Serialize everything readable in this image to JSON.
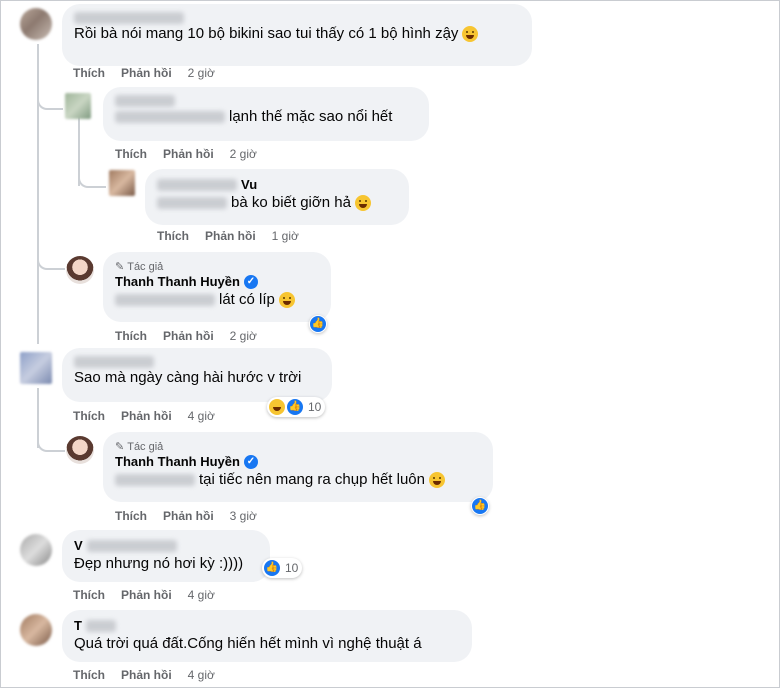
{
  "labels": {
    "like": "Thích",
    "reply": "Phản hồi",
    "author_badge": "Tác giả"
  },
  "comments": [
    {
      "text": "Rồi bà nói mang 10 bộ bikini sao tui thấy có 1 bộ hình zậy",
      "time": "2 giờ"
    },
    {
      "text": "lạnh thế mặc sao nổi hết",
      "time": "2 giờ"
    },
    {
      "name_suffix": "Vu",
      "text": "bà ko biết giỡn hả",
      "time": "1 giờ"
    },
    {
      "name": "Thanh Thanh Huyền",
      "text": "lát có líp",
      "time": "2 giờ"
    },
    {
      "text": "Sao mà ngày càng hài hước v trời",
      "time": "4 giờ",
      "reaction_count": "10"
    },
    {
      "name": "Thanh Thanh Huyền",
      "text": "tại tiếc nên mang ra chụp hết luôn",
      "time": "3 giờ"
    },
    {
      "name_prefix": "V",
      "text": "Đẹp nhưng nó hơi kỳ :))))",
      "time": "4 giờ",
      "reaction_count": "10"
    },
    {
      "name_prefix": "T",
      "text": "Quá trời quá đất.Cống hiến hết mình vì nghệ thuật á",
      "time": "4 giờ"
    }
  ],
  "icons": {
    "laugh": "laughing-emoji-icon",
    "cry": "crying-laugh-emoji-icon",
    "like": "like-reaction-icon",
    "verified": "verified-badge-icon",
    "pencil": "pencil-icon"
  },
  "colors": {
    "bubble": "#f0f2f5",
    "meta": "#65676b",
    "like_blue": "#1877f2"
  }
}
